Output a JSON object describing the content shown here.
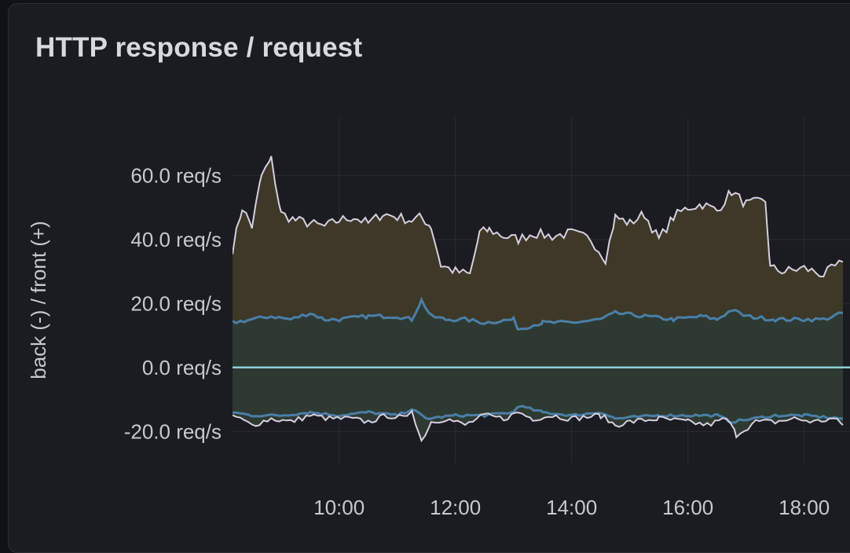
{
  "panel": {
    "title": "HTTP response / request"
  },
  "colors": {
    "background": "#1b1c21",
    "grid": "#2b2c31",
    "zero_line": "#8fd0d6",
    "series_total": "#d6cfe0",
    "series_front": "#4a7fa8",
    "series_back": "#4a7fa8",
    "fill_total": "#3d3828",
    "fill_front": "#2e3a31",
    "fill_back": "#2e3a31"
  },
  "chart_data": {
    "type": "area",
    "title": "",
    "xlabel": "",
    "ylabel": "back (-) / front (+)",
    "y_unit": "req/s",
    "ylim": [
      -30,
      78
    ],
    "y_ticks": [
      60,
      40,
      20,
      0,
      -20
    ],
    "y_tick_labels": [
      "60.0 req/s",
      "40.0 req/s",
      "20.0 req/s",
      "0.0 req/s",
      "-20.0 req/s"
    ],
    "x_range": [
      "08:10",
      "19:40"
    ],
    "x_ticks": [
      "10:00",
      "12:00",
      "14:00",
      "16:00",
      "18:00"
    ],
    "grid": true,
    "legend": "none",
    "series": [
      {
        "x": [
          "08:10",
          "08:20",
          "08:30",
          "08:40",
          "08:50",
          "09:00",
          "09:15",
          "09:30",
          "09:45",
          "10:00",
          "10:15",
          "10:30",
          "10:45",
          "11:00",
          "11:15",
          "11:25",
          "11:35",
          "11:45",
          "12:00",
          "12:15",
          "12:25",
          "12:35",
          "12:50",
          "13:05",
          "13:20",
          "13:40",
          "14:00",
          "14:20",
          "14:35",
          "14:45",
          "15:00",
          "15:15",
          "15:30",
          "15:45",
          "16:00",
          "16:15",
          "16:30",
          "16:45",
          "17:00",
          "17:20",
          "17:25",
          "17:40",
          "18:00",
          "18:20",
          "18:40"
        ],
        "values": [
          37,
          50,
          44,
          60,
          65,
          48,
          46,
          45,
          44,
          46,
          47,
          45,
          48,
          47,
          46,
          47,
          44,
          32,
          30,
          29,
          42,
          43,
          41,
          40,
          42,
          41,
          42,
          40,
          34,
          47,
          45,
          48,
          40,
          47,
          50,
          51,
          49,
          55,
          51,
          52,
          31,
          30,
          31,
          29,
          33
        ]
      },
      {
        "x": [
          "08:10",
          "08:30",
          "08:50",
          "09:10",
          "09:30",
          "09:45",
          "10:00",
          "10:30",
          "11:00",
          "11:15",
          "11:25",
          "11:35",
          "11:50",
          "12:10",
          "12:30",
          "13:00",
          "13:05",
          "13:30",
          "14:00",
          "14:30",
          "14:45",
          "15:15",
          "15:45",
          "16:15",
          "16:30",
          "16:45",
          "17:00",
          "17:30",
          "18:00",
          "18:20",
          "18:40"
        ],
        "values": [
          14,
          15,
          16,
          15,
          17,
          15,
          15,
          16,
          16,
          15,
          21,
          16,
          15,
          15,
          14,
          15,
          12,
          14,
          14,
          15,
          17,
          16,
          15,
          16,
          15,
          18,
          16,
          15,
          15,
          15,
          17
        ]
      },
      {
        "x": [
          "08:10",
          "08:30",
          "08:50",
          "09:10",
          "09:30",
          "09:50",
          "10:10",
          "10:30",
          "10:50",
          "11:10",
          "11:15",
          "11:25",
          "11:35",
          "11:50",
          "12:10",
          "12:30",
          "12:50",
          "13:05",
          "13:20",
          "13:40",
          "14:00",
          "14:30",
          "14:45",
          "15:00",
          "15:30",
          "16:00",
          "16:20",
          "16:40",
          "16:50",
          "17:10",
          "17:30",
          "17:50",
          "18:10",
          "18:30",
          "18:40"
        ],
        "values": [
          -15,
          -18,
          -16,
          -17,
          -15,
          -16,
          -16,
          -17,
          -15,
          -16,
          -13,
          -23,
          -17,
          -16,
          -18,
          -15,
          -16,
          -14,
          -16,
          -15,
          -16,
          -15,
          -18,
          -17,
          -16,
          -17,
          -18,
          -16,
          -21,
          -17,
          -17,
          -16,
          -17,
          -16,
          -18
        ]
      },
      {
        "x": [
          "08:10",
          "08:30",
          "09:00",
          "09:30",
          "10:00",
          "10:30",
          "11:00",
          "11:15",
          "11:30",
          "12:00",
          "12:30",
          "13:00",
          "13:05",
          "13:30",
          "14:00",
          "14:30",
          "14:45",
          "15:30",
          "16:00",
          "16:30",
          "16:45",
          "17:30",
          "18:00",
          "18:40"
        ],
        "values": [
          -14,
          -15,
          -15,
          -14,
          -15,
          -14,
          -15,
          -13,
          -16,
          -15,
          -15,
          -14,
          -12,
          -14,
          -15,
          -14,
          -16,
          -15,
          -15,
          -15,
          -17,
          -15,
          -15,
          -16
        ]
      }
    ]
  }
}
